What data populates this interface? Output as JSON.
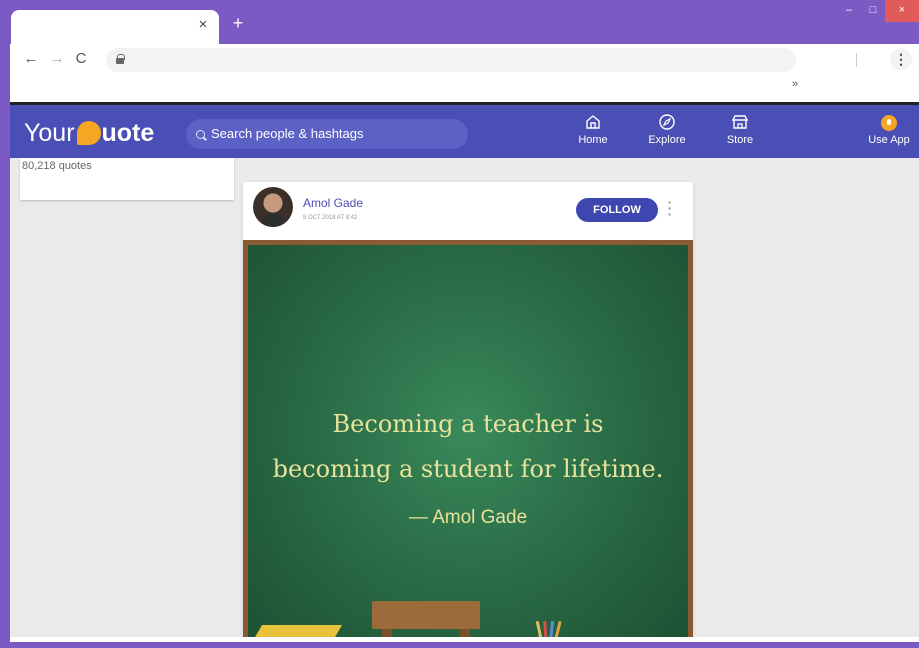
{
  "browser": {
    "tab_close": "×",
    "new_tab": "+",
    "back": "←",
    "forward": "→",
    "reload": "C",
    "menu": "⋮",
    "overflow": "»",
    "minimize": "–",
    "maximize": "□",
    "close": "×"
  },
  "header": {
    "logo_your": "Your",
    "logo_uote": "uote",
    "search_placeholder": "Search people & hashtags",
    "nav": [
      {
        "label": "Home",
        "icon": "home-icon"
      },
      {
        "label": "Explore",
        "icon": "compass-icon"
      },
      {
        "label": "Store",
        "icon": "store-icon"
      },
      {
        "label": "Use App",
        "icon": "app-icon"
      }
    ]
  },
  "profile": {
    "quote_count": "80,218 quotes"
  },
  "post": {
    "author": "Amol Gade",
    "date": "8 OCT 2018 AT 8:42",
    "follow_label": "FOLLOW",
    "quote_line1": "Becoming a teacher is",
    "quote_line2": "becoming a student for lifetime.",
    "quote_attribution": "— Amol Gade"
  },
  "colors": {
    "browser_chrome": "#7b5ac4",
    "header_bg": "#4a4fb5",
    "brand_orange": "#f5a623",
    "chalkboard": "#2c7049",
    "chalk_text": "#e8e39a"
  }
}
